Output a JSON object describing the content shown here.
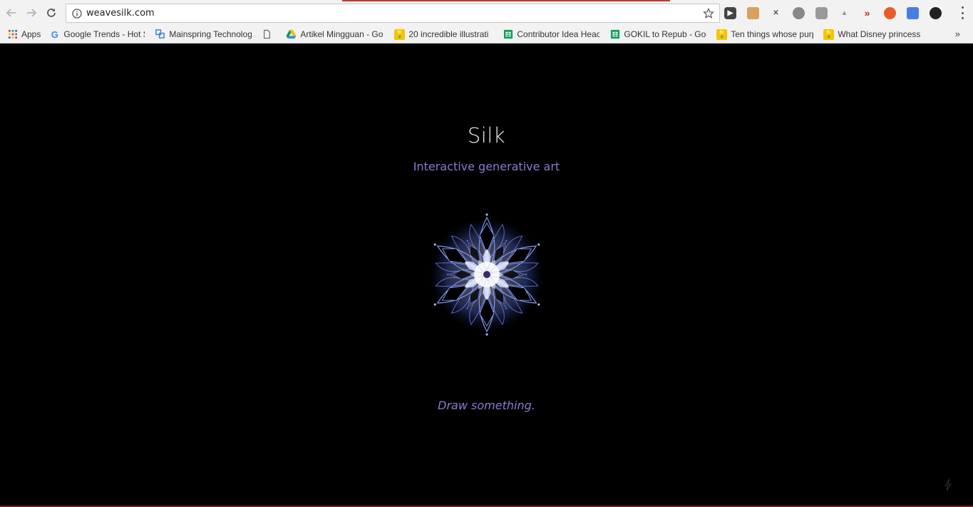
{
  "browser": {
    "url": "weavesilk.com",
    "bookmarks": [
      {
        "label": "Apps",
        "icon": "apps-grid-icon"
      },
      {
        "label": "Google Trends - Hot S",
        "icon": "google-icon"
      },
      {
        "label": "Mainspring Technolog",
        "icon": "mainspring-icon"
      },
      {
        "label": "",
        "icon": "page-icon"
      },
      {
        "label": "Artikel Mingguan - Go",
        "icon": "google-drive-icon"
      },
      {
        "label": "20 incredible illustrati",
        "icon": "lightbulb-icon"
      },
      {
        "label": "Contributor Idea Heac",
        "icon": "sheets-icon"
      },
      {
        "label": "GOKIL to Repub - Goo",
        "icon": "sheets-icon"
      },
      {
        "label": "Ten things whose purp",
        "icon": "lightbulb-icon"
      },
      {
        "label": "What Disney princesse",
        "icon": "lightbulb-icon"
      }
    ],
    "more_bookmarks": "»"
  },
  "page": {
    "title": "Silk",
    "subtitle": "Interactive generative art",
    "prompt": "Draw something."
  },
  "colors": {
    "accent": "#8a7bd0",
    "title": "#eaeaea",
    "background": "#000000"
  }
}
